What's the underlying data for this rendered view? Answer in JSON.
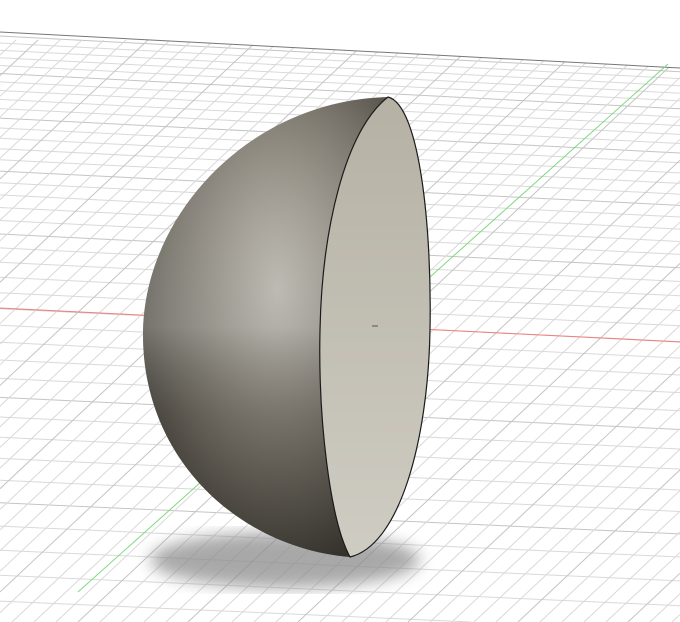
{
  "viewport": {
    "background": "#ffffff",
    "grid_color": "#d9d9d9",
    "grid_major_color": "#c4c4c4",
    "grid_border_color": "#777777",
    "x_axis_color": "#f08080",
    "y_axis_color": "#7fd97f"
  },
  "model": {
    "body": "hemisphere",
    "face_color": "#c9c6bc",
    "surface_color": "#8a8478",
    "shadow_color": "#9a9a9a"
  }
}
